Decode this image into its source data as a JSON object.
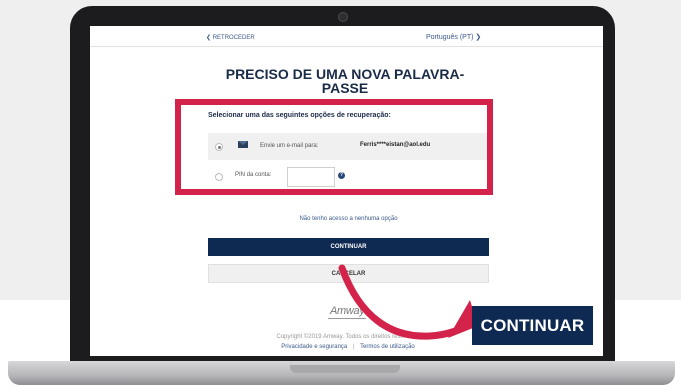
{
  "nav": {
    "back_label": "❮ RETROCEDER",
    "language_label": "Português (PT) ❯"
  },
  "page": {
    "title": "PRECISO DE UMA NOVA PALAVRA-PASSE",
    "subtitle": "Selecionar uma das seguintes opções de recuperação:"
  },
  "options": {
    "email": {
      "label": "Envie um e-mail para:",
      "value": "Ferris****eistan@aol.edu",
      "selected": true
    },
    "pin": {
      "label": "PIN da conta:",
      "value": "",
      "selected": false
    }
  },
  "links": {
    "no_access": "Não tenho acesso a nenhuma opção"
  },
  "buttons": {
    "continue": "CONTINUAR",
    "cancel": "CANCELAR",
    "continue_callout": "CONTINUAR"
  },
  "footer": {
    "logo": "Amway",
    "copyright": "Copyright ©2019 Amway. Todos os direitos reservados.",
    "privacy": "Privacidade e segurança",
    "separator": "|",
    "terms": "Termos de utilização"
  },
  "colors": {
    "navy": "#0f2a52",
    "highlight_red": "#d4234a",
    "laptop": "#1c1c1e"
  },
  "icons": {
    "email": "envelope-icon",
    "help": "question-circle-icon"
  }
}
